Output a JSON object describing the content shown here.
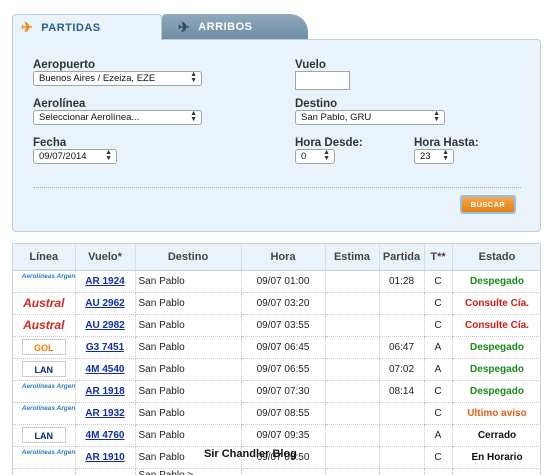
{
  "tabs": {
    "partidas_label": "PARTIDAS",
    "arribos_label": "ARRIBOS",
    "partidas_icon": "plane-departure-icon",
    "arribos_icon": "plane-arrival-icon"
  },
  "form": {
    "aeropuerto_label": "Aeropuerto",
    "aeropuerto_value": "Buenos Aires / Ezeiza, EZE",
    "vuelo_label": "Vuelo",
    "vuelo_value": "",
    "aerolinea_label": "Aerolínea",
    "aerolinea_value": "Seleccionar Aerolínea...",
    "destino_label": "Destino",
    "destino_value": "San Pablo, GRU",
    "fecha_label": "Fecha",
    "fecha_value": "09/07/2014",
    "hora_desde_label": "Hora Desde:",
    "hora_desde_value": "0",
    "hora_hasta_label": "Hora Hasta:",
    "hora_hasta_value": "23",
    "buscar_label": "BUSCAR"
  },
  "table": {
    "headers": [
      "Línea",
      "Vuelo*",
      "Destino",
      "Hora",
      "Estima",
      "Partida",
      "T**",
      "Estado"
    ],
    "rows": [
      {
        "airline": "Aerolíneas Argentinas",
        "logo": "aerolineas-argentinas-logo",
        "vuelo": "AR 1924",
        "destino": "San Pablo",
        "hora": "09/07 01:00",
        "estima": "",
        "partida": "01:28",
        "t": "C",
        "estado": "Despegado",
        "estado_color": "#1a8a1a"
      },
      {
        "airline": "Austral",
        "logo": "austral-logo",
        "vuelo": "AU 2962",
        "destino": "San Pablo",
        "hora": "09/07 03:20",
        "estima": "",
        "partida": "",
        "t": "C",
        "estado": "Consulte Cía.",
        "estado_color": "#d21a1a"
      },
      {
        "airline": "Austral",
        "logo": "austral-logo",
        "vuelo": "AU 2982",
        "destino": "San Pablo",
        "hora": "09/07 03:55",
        "estima": "",
        "partida": "",
        "t": "C",
        "estado": "Consulte Cía.",
        "estado_color": "#d21a1a"
      },
      {
        "airline": "GOL",
        "logo": "gol-logo",
        "vuelo": "G3 7451",
        "destino": "San Pablo",
        "hora": "09/07 06:45",
        "estima": "",
        "partida": "06:47",
        "t": "A",
        "estado": "Despegado",
        "estado_color": "#1a8a1a"
      },
      {
        "airline": "LAN",
        "logo": "lan-logo",
        "vuelo": "4M 4540",
        "destino": "San Pablo",
        "hora": "09/07 06:55",
        "estima": "",
        "partida": "07:02",
        "t": "A",
        "estado": "Despegado",
        "estado_color": "#1a8a1a"
      },
      {
        "airline": "Aerolíneas Argentinas",
        "logo": "aerolineas-argentinas-logo",
        "vuelo": "AR 1918",
        "destino": "San Pablo",
        "hora": "09/07 07:30",
        "estima": "",
        "partida": "08:14",
        "t": "C",
        "estado": "Despegado",
        "estado_color": "#1a8a1a"
      },
      {
        "airline": "Aerolíneas Argentinas",
        "logo": "aerolineas-argentinas-logo",
        "vuelo": "AR 1932",
        "destino": "San Pablo",
        "hora": "09/07 08:55",
        "estima": "",
        "partida": "",
        "t": "C",
        "estado": "Ultimo aviso",
        "estado_color": "#e0601a"
      },
      {
        "airline": "LAN",
        "logo": "lan-logo",
        "vuelo": "4M 4760",
        "destino": "San Pablo",
        "hora": "09/07 09:35",
        "estima": "",
        "partida": "",
        "t": "A",
        "estado": "Cerrado",
        "estado_color": "#111111"
      },
      {
        "airline": "Aerolíneas Argentinas",
        "logo": "aerolineas-argentinas-logo",
        "vuelo": "AR 1910",
        "destino": "San Pablo",
        "hora": "09/07 09:50",
        "estima": "",
        "partida": "",
        "t": "C",
        "estado": "En Horario",
        "estado_color": "#111111"
      },
      {
        "airline": "",
        "logo": "",
        "vuelo": "",
        "destino": "San Pablo >",
        "hora": "",
        "estima": "",
        "partida": "",
        "t": "",
        "estado": "",
        "estado_color": "#111111"
      }
    ]
  },
  "watermark": "Sir Chandler Blog"
}
